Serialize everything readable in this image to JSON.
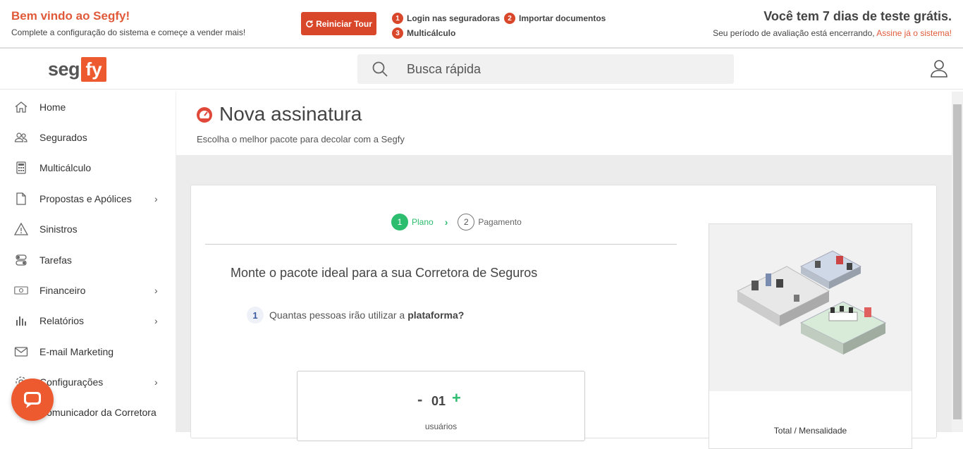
{
  "banner": {
    "welcome_title": "Bem vindo ao Segfy!",
    "welcome_sub": "Complete a configuração do sistema e começe a vender mais!",
    "tour_button": "Reiniciar Tour",
    "steps": [
      {
        "num": "1",
        "label": "Login nas seguradoras"
      },
      {
        "num": "2",
        "label": "Importar documentos"
      },
      {
        "num": "3",
        "label": "Multicálculo"
      }
    ],
    "trial_title": "Você tem 7 dias de teste grátis.",
    "trial_sub": "Seu período de avaliação está encerrando, ",
    "trial_link": "Assine já o sistema!"
  },
  "header": {
    "logo_seg": "seg",
    "logo_fy": "fy",
    "search_placeholder": "Busca rápida"
  },
  "sidebar": {
    "items": [
      {
        "label": "Home",
        "icon": "home-icon",
        "chevron": ""
      },
      {
        "label": "Segurados",
        "icon": "users-icon",
        "chevron": ""
      },
      {
        "label": "Multicálculo",
        "icon": "calculator-icon",
        "chevron": ""
      },
      {
        "label": "Propostas e Apólices",
        "icon": "document-icon",
        "chevron": "›"
      },
      {
        "label": "Sinistros",
        "icon": "warning-icon",
        "chevron": ""
      },
      {
        "label": "Tarefas",
        "icon": "toggles-icon",
        "chevron": ""
      },
      {
        "label": "Financeiro",
        "icon": "money-icon",
        "chevron": "›"
      },
      {
        "label": "Relatórios",
        "icon": "bar-chart-icon",
        "chevron": "›"
      },
      {
        "label": "E-mail Marketing",
        "icon": "mail-icon",
        "chevron": ""
      },
      {
        "label": "Configurações",
        "icon": "gear-icon",
        "chevron": "›"
      },
      {
        "label": "Comunicador da Corretora",
        "icon": "chat-icon",
        "chevron": ""
      }
    ]
  },
  "page": {
    "title": "Nova assinatura",
    "subtitle": "Escolha o melhor pacote para decolar com a Segfy"
  },
  "stepper": {
    "step1_num": "1",
    "step1_label": "Plano",
    "step2_num": "2",
    "step2_label": "Pagamento"
  },
  "plan": {
    "heading": "Monte o pacote ideal para a sua Corretora de Seguros",
    "question_num": "1",
    "question_text": "Quantas pessoas irão utilizar a",
    "question_bold": "plataforma?",
    "counter_minus": "-",
    "counter_value": "01",
    "counter_plus": "+",
    "counter_unit": "usuários"
  },
  "summary": {
    "total_label": "Total / Mensalidade"
  },
  "colors": {
    "accent": "#ed5a2f",
    "success": "#2dbd6e",
    "badge": "#d9472b"
  }
}
